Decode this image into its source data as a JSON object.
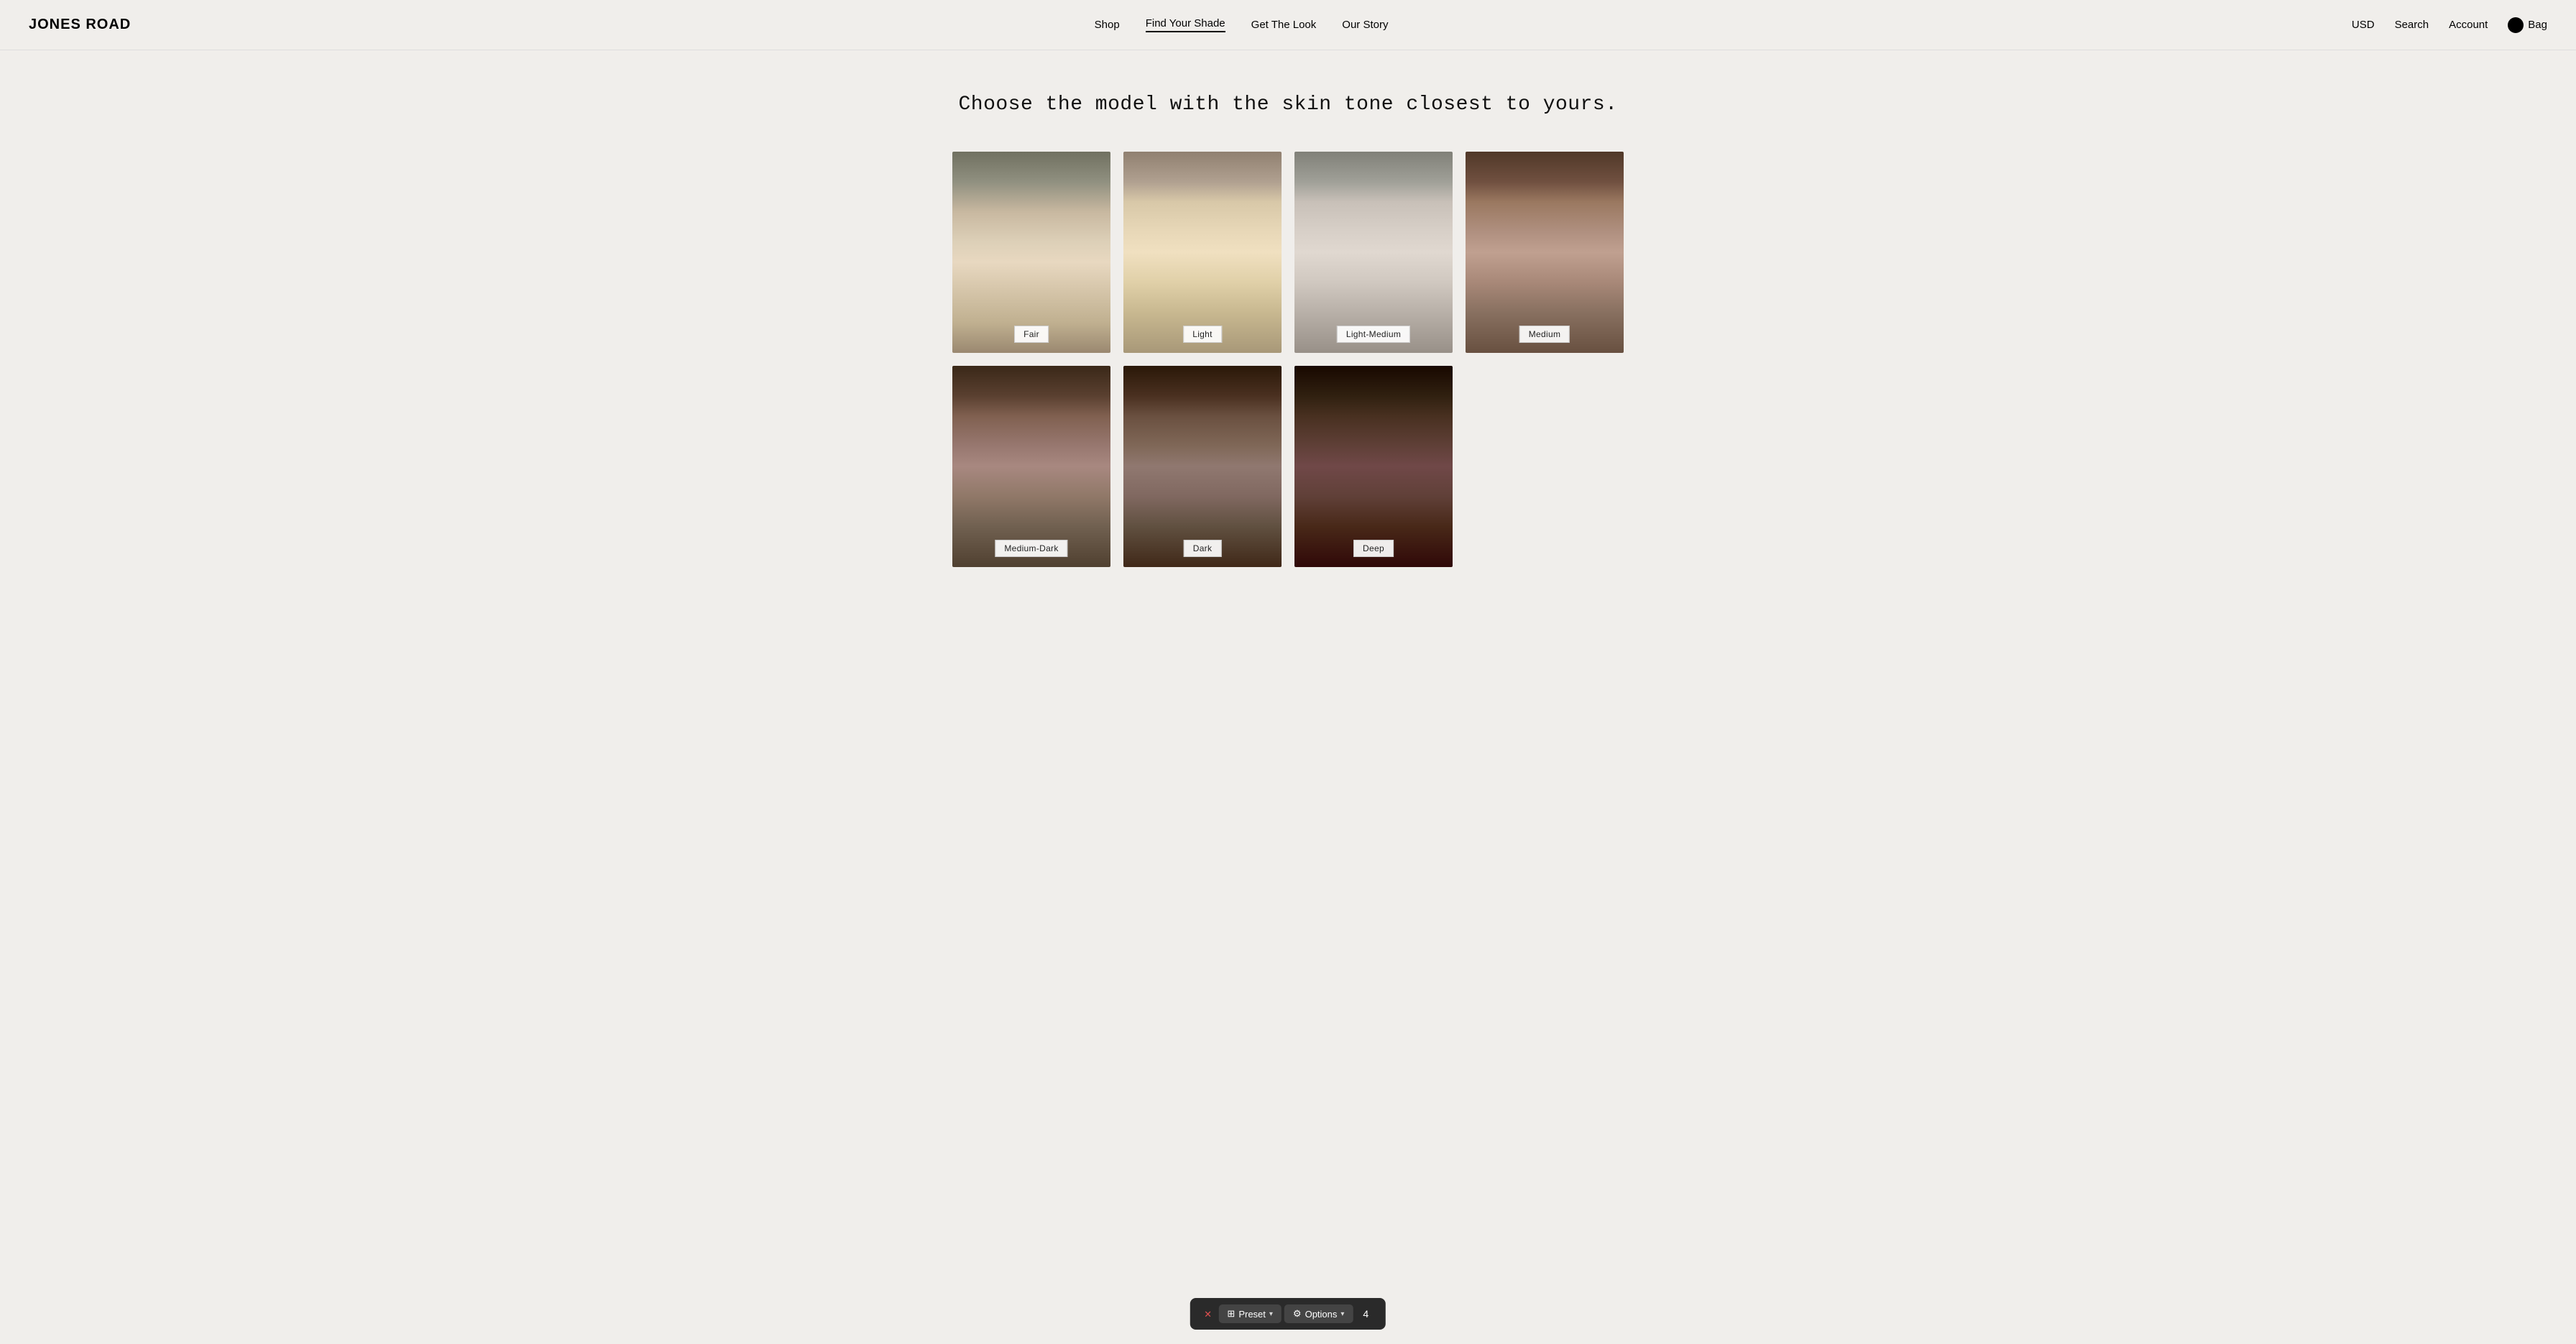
{
  "brand": {
    "logo": "JONES ROAD"
  },
  "header": {
    "nav_items": [
      {
        "label": "Shop",
        "active": false,
        "id": "shop"
      },
      {
        "label": "Find Your Shade",
        "active": true,
        "id": "find-your-shade"
      },
      {
        "label": "Get The Look",
        "active": false,
        "id": "get-the-look"
      },
      {
        "label": "Our Story",
        "active": false,
        "id": "our-story"
      }
    ],
    "right_items": {
      "currency": "USD",
      "search": "Search",
      "account": "Account",
      "bag": "Bag"
    }
  },
  "main": {
    "heading": "Choose the model with the skin tone closest to yours.",
    "models": [
      {
        "id": "fair",
        "shade_label": "Fair",
        "row": 1,
        "face_class": "face-fair"
      },
      {
        "id": "light",
        "shade_label": "Light",
        "row": 1,
        "face_class": "face-light"
      },
      {
        "id": "light-medium",
        "shade_label": "Light-Medium",
        "row": 1,
        "face_class": "face-light-medium"
      },
      {
        "id": "medium",
        "shade_label": "Medium",
        "row": 1,
        "face_class": "face-medium"
      },
      {
        "id": "medium-dark",
        "shade_label": "Medium-Dark",
        "row": 2,
        "face_class": "face-medium-dark"
      },
      {
        "id": "dark",
        "shade_label": "Dark",
        "row": 2,
        "face_class": "face-dark"
      },
      {
        "id": "deep",
        "shade_label": "Deep",
        "row": 2,
        "face_class": "face-deep"
      }
    ]
  },
  "toolbar": {
    "close_icon": "✕",
    "preset_label": "Preset",
    "preset_icon": "⊞",
    "options_label": "Options",
    "options_icon": "⚙",
    "page_number": "4",
    "chevron": "▾"
  }
}
